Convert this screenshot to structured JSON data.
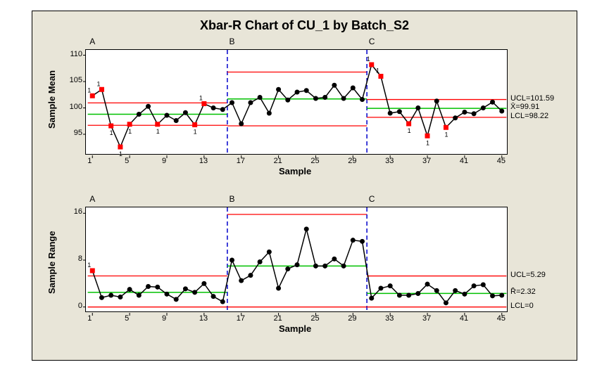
{
  "chart_data": {
    "type": "line",
    "title": "Xbar-R Chart of CU_1 by Batch_S2",
    "xlabel": "Sample",
    "colors": {
      "point": "#000000",
      "out": "#ff0000",
      "ucl": "#ff0000",
      "cl": "#00c000",
      "stage": "#0000cc"
    },
    "x": [
      1,
      2,
      3,
      4,
      5,
      6,
      7,
      8,
      9,
      10,
      11,
      12,
      13,
      14,
      15,
      16,
      17,
      18,
      19,
      20,
      21,
      22,
      23,
      24,
      25,
      26,
      27,
      28,
      29,
      30,
      31,
      32,
      33,
      34,
      35,
      36,
      37,
      38,
      39,
      40,
      41,
      42,
      43,
      44,
      45
    ],
    "xrange": [
      0.3,
      45.7
    ],
    "xticks": [
      1,
      5,
      9,
      13,
      17,
      21,
      25,
      29,
      33,
      37,
      41,
      45
    ],
    "stages": [
      {
        "name": "A",
        "first": 1,
        "last": 15
      },
      {
        "name": "B",
        "first": 16,
        "last": 30
      },
      {
        "name": "C",
        "first": 31,
        "last": 45
      }
    ],
    "series": [
      {
        "id": "xbar",
        "ylabel": "Sample Mean",
        "ylim": [
          91,
          111
        ],
        "yticks": [
          95,
          100,
          105,
          110
        ],
        "values": [
          102.3,
          103.5,
          96.6,
          92.6,
          96.9,
          98.8,
          100.3,
          96.9,
          98.6,
          97.6,
          99.1,
          96.8,
          100.8,
          100.0,
          99.7,
          101.0,
          97.0,
          101.0,
          102.0,
          99.0,
          103.5,
          101.5,
          103.0,
          103.3,
          101.8,
          102.0,
          104.3,
          101.8,
          103.8,
          101.6,
          108.2,
          106.0,
          99.0,
          99.3,
          97.0,
          100.0,
          94.7,
          101.3,
          96.3,
          98.1,
          99.2,
          98.9,
          100.0,
          101.1,
          99.4
        ],
        "out": [
          1,
          2,
          3,
          4,
          5,
          8,
          12,
          13,
          31,
          32,
          35,
          37,
          39
        ],
        "stage_limits": [
          {
            "ucl": 100.95,
            "cl": 98.8,
            "lcl": 96.7
          },
          {
            "ucl": 106.8,
            "cl": 101.7,
            "lcl": 96.6
          },
          {
            "ucl": 101.59,
            "cl": 99.91,
            "lcl": 98.22
          }
        ],
        "right_labels": [
          {
            "text": "UCL=101.59",
            "y": 101.59
          },
          {
            "text": "X̄=99.91",
            "y": 99.91
          },
          {
            "text": "LCL=98.22",
            "y": 98.22
          }
        ]
      },
      {
        "id": "r",
        "ylabel": "Sample Range",
        "ylim": [
          -1,
          17
        ],
        "yticks": [
          0,
          8,
          16
        ],
        "values": [
          6.2,
          1.6,
          2.0,
          1.7,
          3.0,
          2.0,
          3.5,
          3.4,
          2.2,
          1.3,
          3.1,
          2.5,
          4.0,
          1.8,
          0.9,
          8.0,
          4.5,
          5.4,
          7.7,
          9.4,
          3.2,
          6.5,
          7.2,
          13.3,
          7.0,
          7.0,
          8.2,
          7.0,
          11.4,
          11.2,
          1.5,
          3.2,
          3.6,
          2.0,
          2.0,
          2.3,
          3.9,
          2.8,
          0.7,
          2.8,
          2.2,
          3.6,
          3.8,
          1.9,
          2.0
        ],
        "out": [
          1
        ],
        "stage_limits": [
          {
            "ucl": 5.3,
            "cl": 2.5,
            "lcl": 0
          },
          {
            "ucl": 15.8,
            "cl": 7.0,
            "lcl": 0
          },
          {
            "ucl": 5.29,
            "cl": 2.32,
            "lcl": 0
          }
        ],
        "right_labels": [
          {
            "text": "UCL=5.29",
            "y": 5.29
          },
          {
            "text": "R̄=2.32",
            "y": 2.32
          },
          {
            "text": "LCL=0",
            "y": 0
          }
        ]
      }
    ]
  }
}
